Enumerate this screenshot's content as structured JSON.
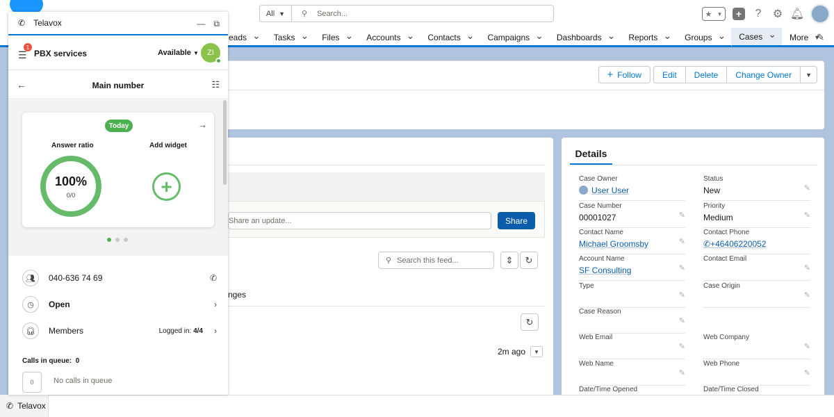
{
  "header": {
    "search_scope": "All",
    "search_placeholder": "Search..."
  },
  "nav": {
    "items": [
      {
        "label": "Leads",
        "display": "eads"
      },
      {
        "label": "Tasks"
      },
      {
        "label": "Files"
      },
      {
        "label": "Accounts"
      },
      {
        "label": "Contacts"
      },
      {
        "label": "Campaigns"
      },
      {
        "label": "Dashboards"
      },
      {
        "label": "Reports"
      },
      {
        "label": "Groups"
      },
      {
        "label": "Cases",
        "active": true
      },
      {
        "label": "More"
      }
    ]
  },
  "actions": {
    "follow": "Follow",
    "edit": "Edit",
    "delete": "Delete",
    "change_owner": "Change Owner"
  },
  "feed": {
    "share_placeholder": "Share an update...",
    "share_label": "Share",
    "search_placeholder": "Search this feed...",
    "changes_text": "nges",
    "time_ago": "2m ago"
  },
  "details": {
    "tab": "Details",
    "fields": [
      {
        "label": "Case Owner",
        "value": "User User",
        "link": true
      },
      {
        "label": "Status",
        "value": "New"
      },
      {
        "label": "Case Number",
        "value": "00001027"
      },
      {
        "label": "Priority",
        "value": "Medium"
      },
      {
        "label": "Contact Name",
        "value": "Michael Groomsby",
        "link": true
      },
      {
        "label": "Contact Phone",
        "value": "+46406220052",
        "link": true
      },
      {
        "label": "Account Name",
        "value": "SF Consulting",
        "link": true
      },
      {
        "label": "Contact Email",
        "value": ""
      },
      {
        "label": "Type",
        "value": ""
      },
      {
        "label": "Case Origin",
        "value": ""
      },
      {
        "label": "Case Reason",
        "value": ""
      },
      {
        "label": "",
        "value": ""
      },
      {
        "label": "Web Email",
        "value": ""
      },
      {
        "label": "Web Company",
        "value": ""
      },
      {
        "label": "Web Name",
        "value": ""
      },
      {
        "label": "Web Phone",
        "value": ""
      },
      {
        "label": "Date/Time Opened",
        "value": ""
      },
      {
        "label": "Date/Time Closed",
        "value": ""
      }
    ]
  },
  "telavox": {
    "title": "Telavox",
    "badge": "1",
    "pbx_label": "PBX services",
    "availability": "Available",
    "avatar_initials": "ZI",
    "main_number_title": "Main number",
    "today": "Today",
    "answer_ratio_label": "Answer ratio",
    "answer_ratio_value": "100%",
    "answer_ratio_fraction": "0/0",
    "add_widget_label": "Add widget",
    "phone_number": "040-636 74 69",
    "open_label": "Open",
    "members_label": "Members",
    "logged_in_label": "Logged in:",
    "logged_in_value": "4/4",
    "calls_in_queue_label": "Calls in queue:",
    "calls_in_queue_value": "0",
    "queue_count": "0",
    "no_calls": "No calls in queue"
  },
  "utility_bar": {
    "tab_label": "Telavox"
  },
  "colors": {
    "brand_blue": "#0176d3",
    "green": "#4caf50",
    "badge_red": "#e8553e"
  }
}
